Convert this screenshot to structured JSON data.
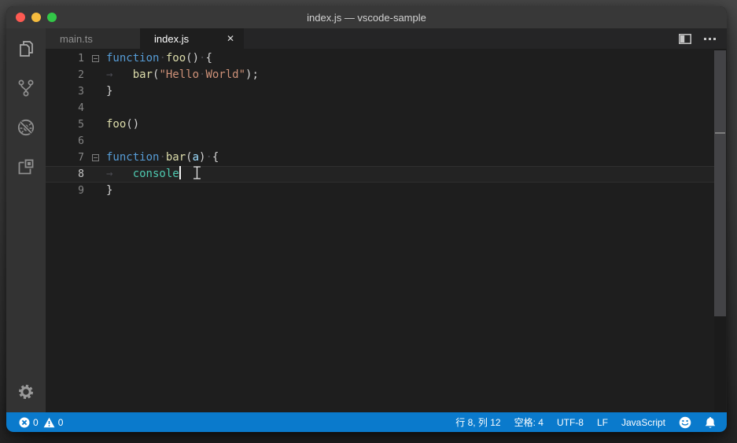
{
  "window": {
    "title": "index.js — vscode-sample",
    "background": "#1e1e1e",
    "titlebar_color": "#383838",
    "accent": "#0a7acc"
  },
  "activity_bar": {
    "items": [
      {
        "id": "explorer",
        "icon": "files-icon"
      },
      {
        "id": "source-control",
        "icon": "git-branch-icon"
      },
      {
        "id": "debug",
        "icon": "bug-slash-icon"
      },
      {
        "id": "extensions",
        "icon": "extensions-icon"
      }
    ],
    "bottom": {
      "id": "settings",
      "icon": "gear-icon"
    }
  },
  "tab_bar": {
    "tabs": [
      {
        "label": "main.ts",
        "active": false
      },
      {
        "label": "index.js",
        "active": true,
        "close_glyph": "✕"
      }
    ],
    "actions": {
      "split_icon": "split-editor-icon",
      "more_icon": "more-actions-icon"
    }
  },
  "editor": {
    "language": "javascript",
    "current_line": 8,
    "lines": [
      {
        "num": 1,
        "fold": true,
        "tokens": [
          {
            "t": "function",
            "c": "kw"
          },
          {
            "t": "·",
            "c": "ws"
          },
          {
            "t": "foo",
            "c": "fn"
          },
          {
            "t": "()",
            "c": "pl"
          },
          {
            "t": "·",
            "c": "ws"
          },
          {
            "t": "{",
            "c": "pl"
          }
        ]
      },
      {
        "num": 2,
        "fold": false,
        "tokens": [
          {
            "t": "→",
            "c": "arrow"
          },
          {
            "t": "bar",
            "c": "fn"
          },
          {
            "t": "(",
            "c": "pl"
          },
          {
            "t": "\"Hello",
            "c": "str"
          },
          {
            "t": "·",
            "c": "ws"
          },
          {
            "t": "World\"",
            "c": "str"
          },
          {
            "t": ");",
            "c": "pl"
          }
        ]
      },
      {
        "num": 3,
        "fold": false,
        "tokens": [
          {
            "t": "}",
            "c": "pl"
          }
        ]
      },
      {
        "num": 4,
        "fold": false,
        "tokens": []
      },
      {
        "num": 5,
        "fold": false,
        "tokens": [
          {
            "t": "foo",
            "c": "fn"
          },
          {
            "t": "()",
            "c": "pl"
          }
        ]
      },
      {
        "num": 6,
        "fold": false,
        "tokens": []
      },
      {
        "num": 7,
        "fold": true,
        "tokens": [
          {
            "t": "function",
            "c": "kw"
          },
          {
            "t": "·",
            "c": "ws"
          },
          {
            "t": "bar",
            "c": "fn"
          },
          {
            "t": "(",
            "c": "pl"
          },
          {
            "t": "a",
            "c": "param"
          },
          {
            "t": ")",
            "c": "pl"
          },
          {
            "t": "·",
            "c": "ws"
          },
          {
            "t": "{",
            "c": "pl"
          }
        ]
      },
      {
        "num": 8,
        "fold": false,
        "caret": true,
        "tokens": [
          {
            "t": "→",
            "c": "arrow"
          },
          {
            "t": "console",
            "c": "obj"
          }
        ]
      },
      {
        "num": 9,
        "fold": false,
        "tokens": [
          {
            "t": "}",
            "c": "pl"
          }
        ]
      }
    ],
    "token_colors": {
      "keyword": "#569cd6",
      "function": "#dcdcaa",
      "string": "#ce9178",
      "parameter": "#9cdcfe",
      "builtin": "#4ec9b0",
      "punctuation": "#d4d4d4",
      "whitespace": "#4b4b52"
    }
  },
  "status_bar": {
    "errors": "0",
    "warnings": "0",
    "line_col": "行 8, 列 12",
    "indentation": "空格: 4",
    "encoding": "UTF-8",
    "eol": "LF",
    "language": "JavaScript",
    "icons": [
      "error-circle-icon",
      "warning-triangle-icon",
      "feedback-smiley-icon",
      "notifications-bell-icon"
    ]
  }
}
